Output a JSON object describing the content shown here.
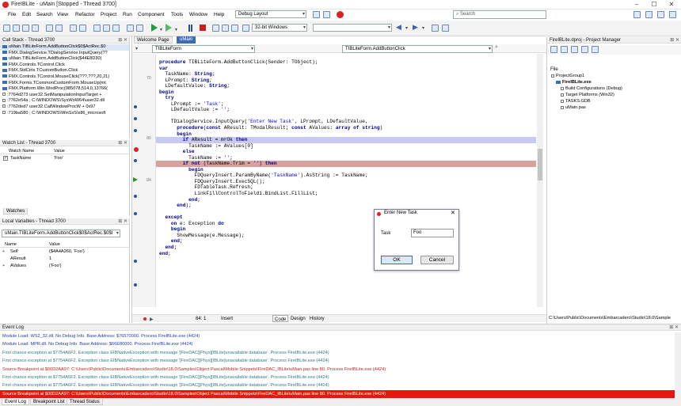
{
  "title": "FireIBLite - uMain [Stopped - Thread 3700]",
  "menu": [
    "File",
    "Edit",
    "Search",
    "View",
    "Refactor",
    "Project",
    "Run",
    "Component",
    "Tools",
    "Window",
    "Help"
  ],
  "layout_combo": "Debug Layout",
  "search_placeholder": "Search",
  "platform_combo": "32-bit Windows",
  "call_stack": {
    "title": "Call Stack - Thread 3700",
    "items": [
      "uMain.TIBLiteForm.AddButtonClick$0$ActRec.$0",
      "FMX.DialogService.TDialogService.InputQuery(??",
      "uMain.TIBLiteForm.AddButtonClick($44E8D30)",
      "FMX.Controls.TControl.Click",
      "FMX.StdCtrls.TCustomButton.Click",
      "FMX.Controls.TControl.MouseClick(???,???,20,21)",
      "FMX.Forms.TCommonCustomForm.MouseUp(mt",
      "FMX.Platform.Win.WndProc(985078,514,0,13766(",
      ":7764d273 user32.SetManipulationInputTarget +",
      ":7762e54a ; C:\\WINDOWS\\SysWoW64\\user32.dll",
      ":7762ded7 user32.CallWindowProcW + 0x97",
      ":719ba580 ; C:\\WINDOWS\\WinSxS\\x86_microsoft"
    ]
  },
  "watch": {
    "title": "Watch List - Thread 3700",
    "col_name": "Watch Name",
    "col_value": "Value",
    "rows": [
      {
        "name": "TaskName",
        "value": "'Foo'"
      }
    ],
    "tab": "Watches"
  },
  "locals": {
    "title": "Local Variables - Thread 3700",
    "combo": "uMain.TIBLiteForm.AddButtonClick$0$ActRec.$0$I",
    "col_name": "Name",
    "col_value": "Value",
    "rows": [
      {
        "name": "Self",
        "value": "($4A4A260, 'Foo')"
      },
      {
        "name": "AResult",
        "value": "1"
      },
      {
        "name": "AValues",
        "value": "('Foo')"
      }
    ]
  },
  "editor": {
    "tab_welcome": "Welcome Page",
    "tab_main": "uMain",
    "class_combo": "TIBLiteForm",
    "method_combo": "TIBLiteForm.AddButtonClick",
    "line_70": "70",
    "line_80": "80",
    "line_84": "84",
    "status_pos": "84: 1",
    "status_mode": "Insert",
    "tab_code": "Code",
    "tab_design": "Design",
    "tab_history": "History"
  },
  "dialog": {
    "title": "Enter New Task",
    "label": "Task",
    "value": "Foo",
    "ok": "OK",
    "cancel": "Cancel"
  },
  "project": {
    "title": "FireIBLite.dproj - Project Manager",
    "file_label": "File",
    "items": [
      "ProjectGroup1",
      "FireIBLite.exe",
      "Build Configurations (Debug)",
      "Target Platforms (Win32)",
      "TASKS.GDB",
      "uMain.pas"
    ],
    "path": "C:\\Users\\Public\\Documents\\Embarcadero\\Studio\\18.0\\Sample"
  },
  "event_log": {
    "title": "Event Log",
    "rows": [
      "Module Load: WS2_32.dll. No Debug Info. Base Address: $76570000. Process FireIBLite.exe (4424)",
      "Module Load: MPR.dll. No Debug Info. Base Address: $66E80000. Process FireIBLite.exe (4424)",
      "First chance exception at $7754A6F2. Exception class EIBNativeException with message '[FireDAC][Phys][IBLite]unavailable database'. Process FireIBLite.exe (4424)",
      "First chance exception at $7754A6F2. Exception class EIBNativeException with message '[FireDAC][Phys][IBLite]unavailable database'. Process FireIBLite.exe (4424)",
      "Source Breakpoint at $00D2AA97: C:\\Users\\Public\\Documents\\Embarcadero\\Studio\\18.0\\Samples\\Object Pascal\\Mobile Snippets\\FireDAC_IBLite\\uMain.pas line 80. Process FireIBLite.exe (4424)",
      "First chance exception at $7754A6F2. Exception class EIBNativeException with message '[FireDAC][Phys][IBLite]unavailable database'. Process FireIBLite.exe (4424)",
      "First chance exception at $7754A6F2. Exception class EIBNativeException with message '[FireDAC][Phys][IBLite]unavailable database'. Process FireIBLite.exe (4424)",
      "Source Breakpoint at $00D2AA97: C:\\Users\\Public\\Documents\\Embarcadero\\Studio\\18.0\\Samples\\Object Pascal\\Mobile Snippets\\FireDAC_IBLite\\uMain.pas line 80. Process FireIBLite.exe (4424)"
    ],
    "tabs": [
      "Event Log",
      "Breakpoint List",
      "Thread Status"
    ]
  },
  "colors": {
    "accent": "#3b6db4",
    "breakpoint_line": "#d9a0a0",
    "exec_line": "#c8c8f4",
    "error_row": "#e8160c"
  }
}
